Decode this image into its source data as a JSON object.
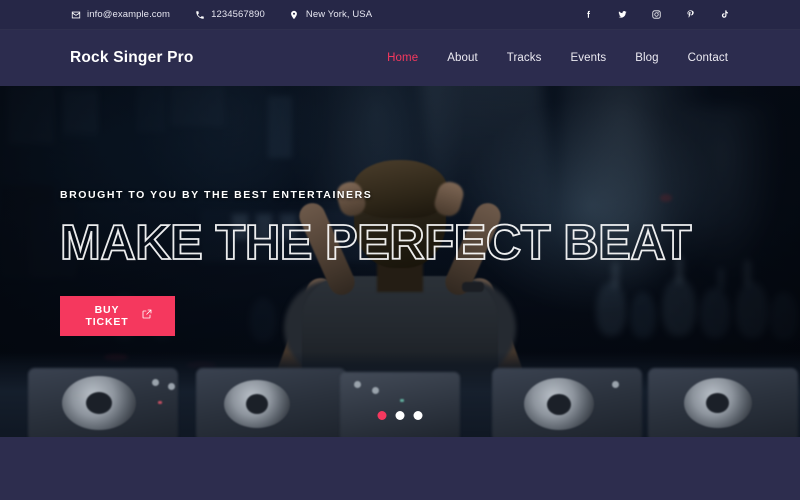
{
  "topbar": {
    "contacts": [
      {
        "icon": "envelope-icon",
        "text": "info@example.com"
      },
      {
        "icon": "phone-icon",
        "text": "1234567890"
      },
      {
        "icon": "location-pin-icon",
        "text": "New York, USA"
      }
    ],
    "socials": [
      {
        "icon": "facebook-icon",
        "label": "Facebook"
      },
      {
        "icon": "twitter-icon",
        "label": "Twitter"
      },
      {
        "icon": "instagram-icon",
        "label": "Instagram"
      },
      {
        "icon": "pinterest-icon",
        "label": "Pinterest"
      },
      {
        "icon": "tiktok-icon",
        "label": "TikTok"
      }
    ]
  },
  "header": {
    "brand": "Rock Singer Pro",
    "nav": [
      {
        "label": "Home",
        "active": true
      },
      {
        "label": "About",
        "active": false
      },
      {
        "label": "Tracks",
        "active": false
      },
      {
        "label": "Events",
        "active": false
      },
      {
        "label": "Blog",
        "active": false
      },
      {
        "label": "Contact",
        "active": false
      }
    ]
  },
  "hero": {
    "eyebrow": "BROUGHT TO YOU BY THE BEST ENTERTAINERS",
    "headline": "MAKE THE PERFECT BEAT",
    "cta_label": "Buy Ticket",
    "cta_icon": "external-link-icon",
    "image_description": "DJ seen from behind with hands raised to his head standing at a lit mixing console in front of a blue-lit concert crowd",
    "slider_dots": [
      {
        "active": true
      },
      {
        "active": false
      },
      {
        "active": false
      }
    ]
  },
  "colors": {
    "accent": "#f5385e",
    "topbar_bg": "#262747",
    "nav_bg": "#2c2c4e",
    "footer_bg": "#2d2d4e",
    "text_light": "#ffffff"
  }
}
